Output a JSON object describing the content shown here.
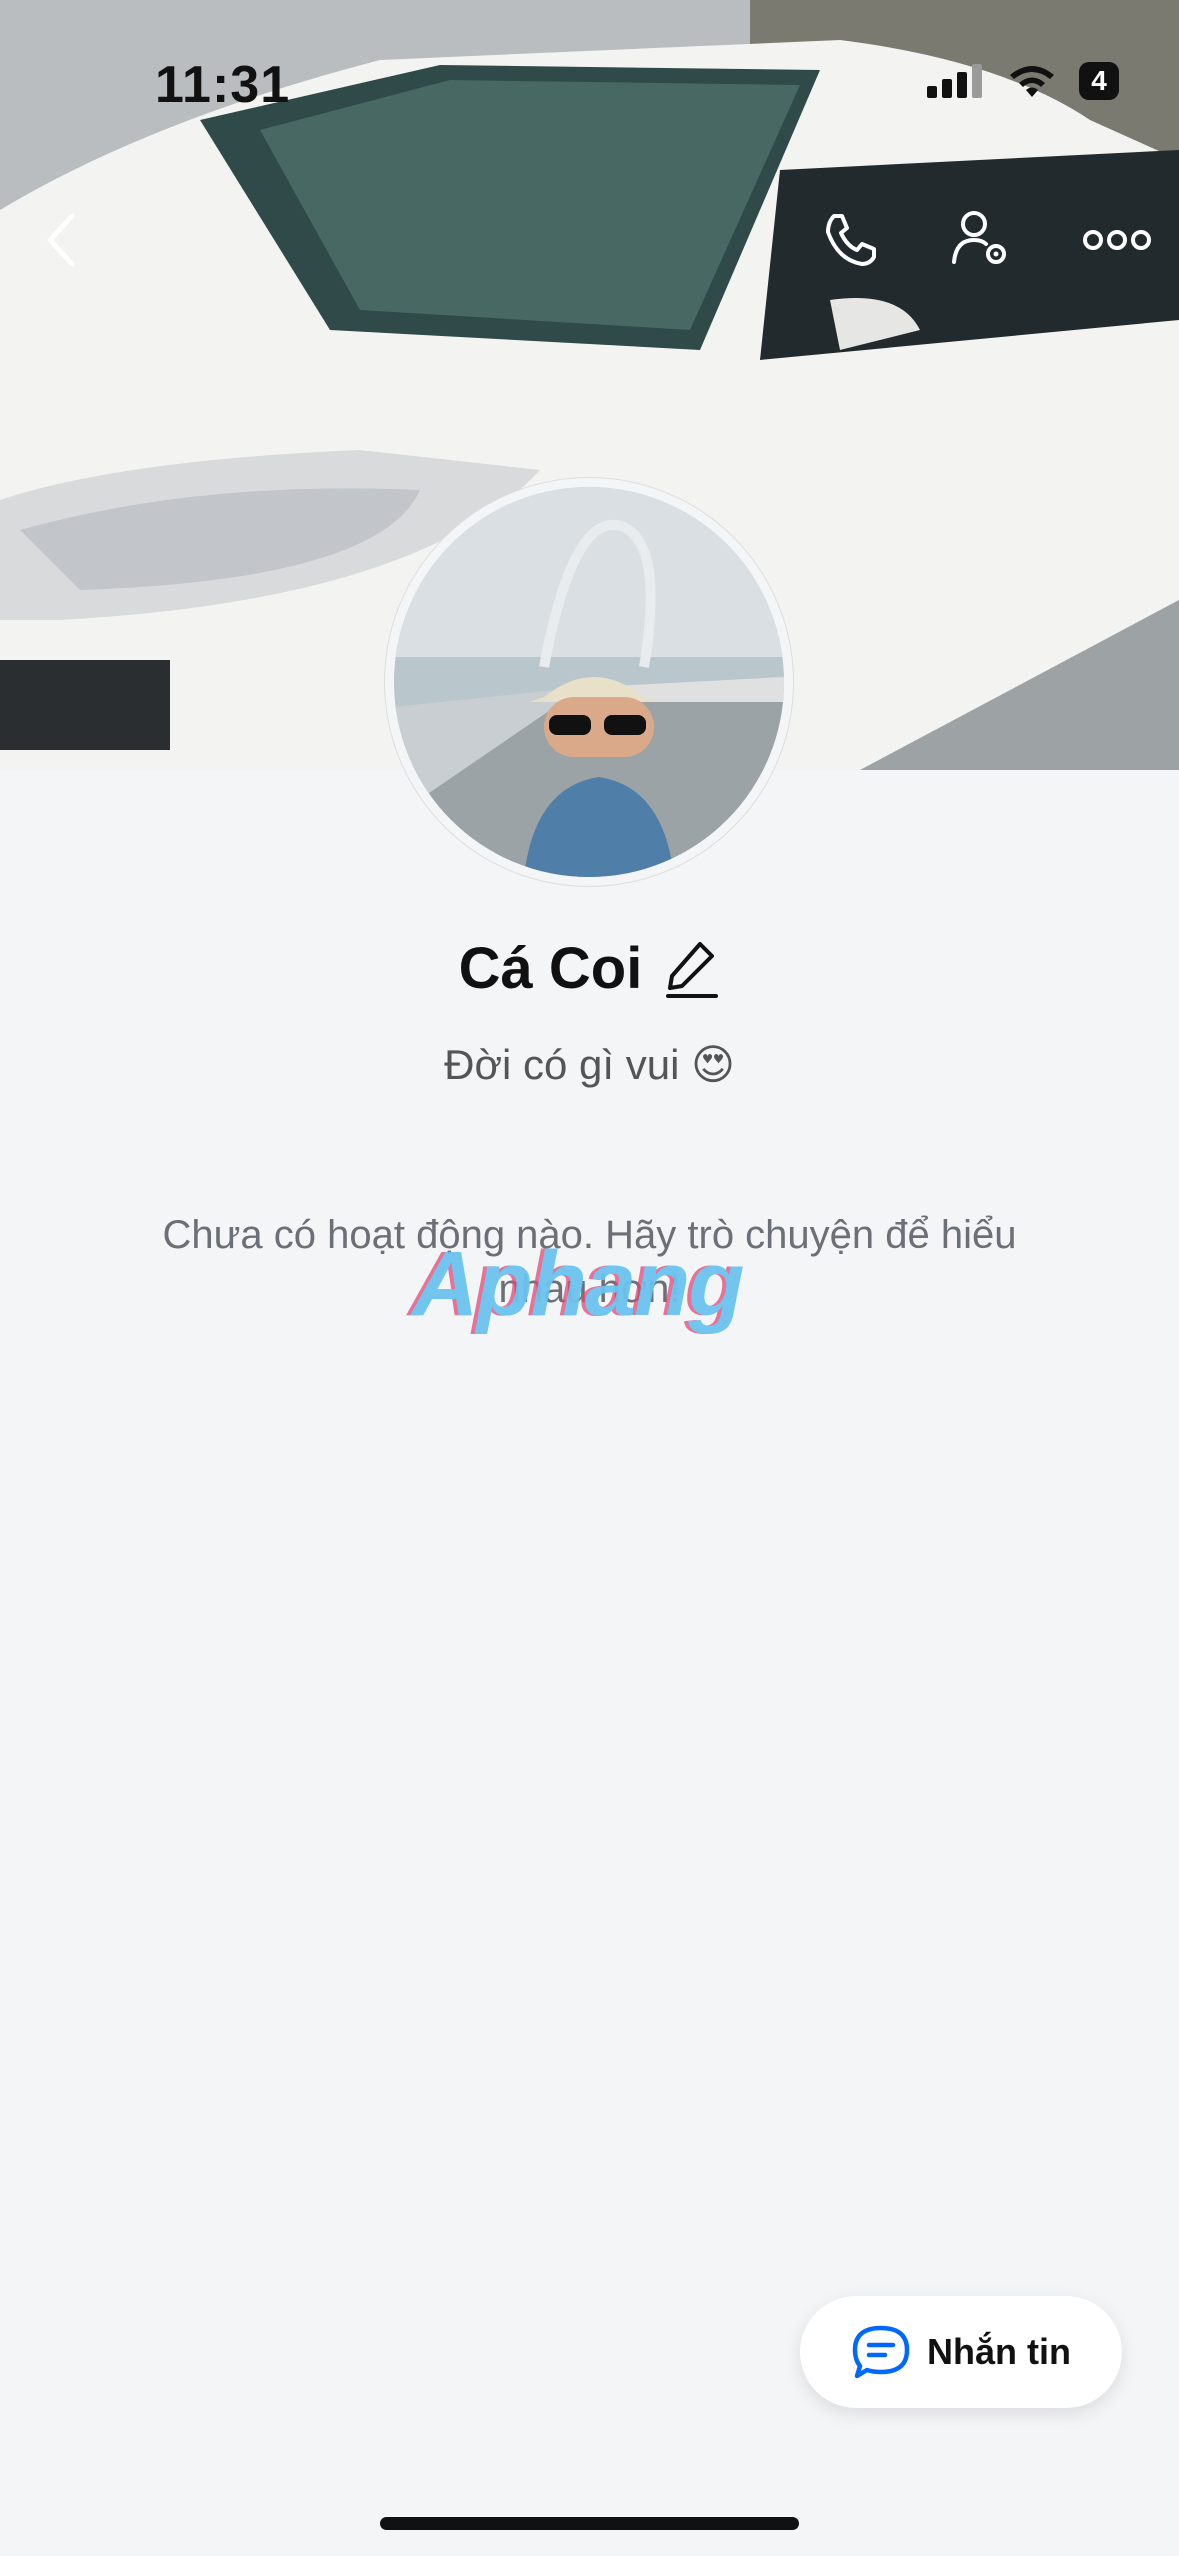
{
  "status_bar": {
    "time": "11:31",
    "battery": "4"
  },
  "profile": {
    "name": "Cá Coi",
    "bio": "Đời có gì vui",
    "bio_emoji": "😍"
  },
  "empty_state": "Chưa có hoạt động nào. Hãy trò chuyện để hiểu nhau hơn!",
  "watermark": "Aphang",
  "message_button": {
    "label": "Nhắn tin"
  },
  "icons": {
    "back": "back-arrow-icon",
    "call": "phone-icon",
    "settings": "user-settings-icon",
    "more": "more-icon",
    "edit": "pencil-icon",
    "chat": "chat-bubble-icon"
  },
  "colors": {
    "accent": "#0068ff",
    "background": "#f4f5f7"
  }
}
